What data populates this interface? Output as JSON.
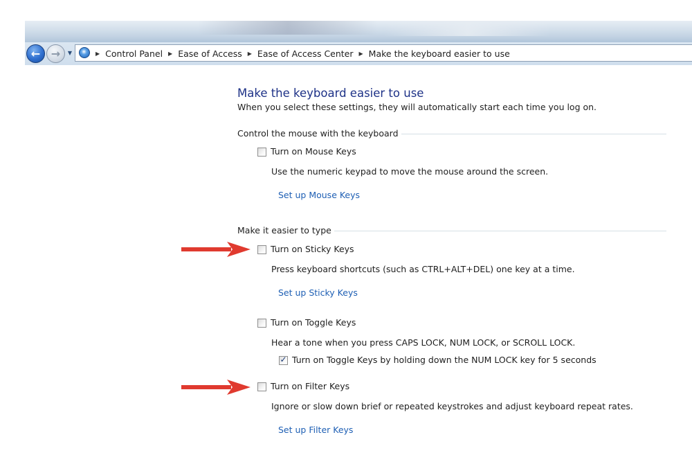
{
  "breadcrumb": {
    "items": [
      "Control Panel",
      "Ease of Access",
      "Ease of Access Center",
      "Make the keyboard easier to use"
    ]
  },
  "page": {
    "title": "Make the keyboard easier to use",
    "subtitle": "When you select these settings, they will automatically start each time you log on."
  },
  "mouse_section": {
    "heading": "Control the mouse with the keyboard",
    "mouse_keys": {
      "label": "Turn on Mouse Keys",
      "checked": false,
      "description": "Use the numeric keypad to move the mouse around the screen.",
      "setup_link": "Set up Mouse Keys"
    }
  },
  "typing_section": {
    "heading": "Make it easier to type",
    "sticky_keys": {
      "label": "Turn on Sticky Keys",
      "checked": false,
      "description": "Press keyboard shortcuts (such as CTRL+ALT+DEL) one key at a time.",
      "setup_link": "Set up Sticky Keys"
    },
    "toggle_keys": {
      "label": "Turn on Toggle Keys",
      "checked": false,
      "description": "Hear a tone when you press CAPS LOCK, NUM LOCK, or SCROLL LOCK.",
      "sub_option": {
        "label": "Turn on Toggle Keys by holding down the NUM LOCK key for 5 seconds",
        "checked": true
      }
    },
    "filter_keys": {
      "label": "Turn on Filter Keys",
      "checked": false,
      "description": "Ignore or slow down brief or repeated keystrokes and adjust keyboard repeat rates.",
      "setup_link": "Set up Filter Keys"
    }
  },
  "colors": {
    "title": "#1e3287",
    "link": "#1e5fb4",
    "annotation_arrow": "#e03a2f",
    "separator": "#d5dfe5"
  },
  "icons": {
    "back": "back-arrow-icon",
    "forward": "forward-arrow-icon",
    "recent_pages": "chevron-down-icon",
    "control_panel": "control-panel-icon",
    "breadcrumb_separator": "chevron-right-icon",
    "annotation": "red-arrow-icon"
  }
}
